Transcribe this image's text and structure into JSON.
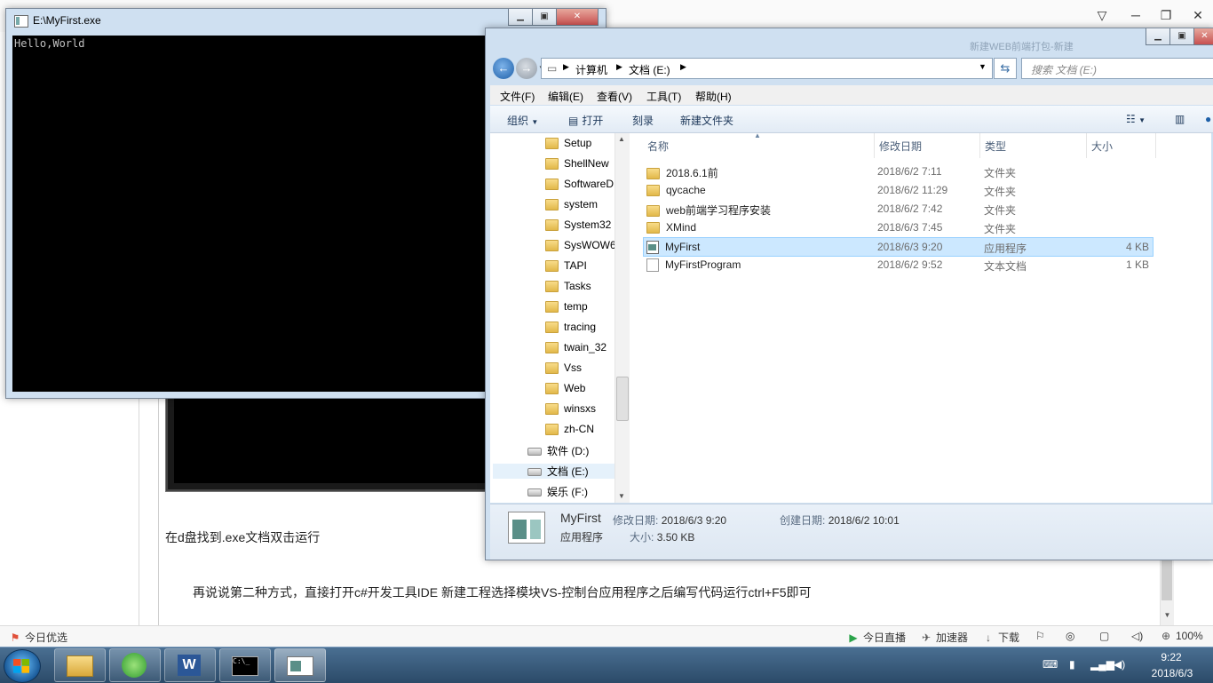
{
  "browser": {
    "caption": "在d盘找到.exe文档双击运行",
    "paragraph": "再说说第二种方式，直接打开c#开发工具IDE  新建工程选择模块VS-控制台应用程序之后编写代码运行ctrl+F5即可",
    "statusbar": {
      "left_label": "今日优选",
      "live": "今日直播",
      "accelerator": "加速器",
      "download": "下载",
      "zoom": "100%"
    }
  },
  "console": {
    "title": "E:\\MyFirst.exe",
    "output": "Hello,World"
  },
  "explorer": {
    "faded_title": "新建WEB前端打包-新建",
    "address": {
      "seg1": "计算机",
      "seg2": "文档 (E:)"
    },
    "search_placeholder": "搜索 文档 (E:)",
    "menu": [
      "文件(F)",
      "编辑(E)",
      "查看(V)",
      "工具(T)",
      "帮助(H)"
    ],
    "toolbar": {
      "organize": "组织",
      "open": "打开",
      "burn": "刻录",
      "new_folder": "新建文件夹"
    },
    "tree": [
      {
        "label": "Setup",
        "type": "folder"
      },
      {
        "label": "ShellNew",
        "type": "folder"
      },
      {
        "label": "SoftwareD",
        "type": "folder"
      },
      {
        "label": "system",
        "type": "folder"
      },
      {
        "label": "System32",
        "type": "folder"
      },
      {
        "label": "SysWOW6",
        "type": "folder"
      },
      {
        "label": "TAPI",
        "type": "folder"
      },
      {
        "label": "Tasks",
        "type": "folder"
      },
      {
        "label": "temp",
        "type": "folder"
      },
      {
        "label": "tracing",
        "type": "folder"
      },
      {
        "label": "twain_32",
        "type": "folder"
      },
      {
        "label": "Vss",
        "type": "folder"
      },
      {
        "label": "Web",
        "type": "folder"
      },
      {
        "label": "winsxs",
        "type": "folder"
      },
      {
        "label": "zh-CN",
        "type": "folder"
      },
      {
        "label": "软件 (D:)",
        "type": "drive"
      },
      {
        "label": "文档 (E:)",
        "type": "drive"
      },
      {
        "label": "娱乐 (F:)",
        "type": "drive"
      }
    ],
    "columns": {
      "name": "名称",
      "modified": "修改日期",
      "type": "类型",
      "size": "大小"
    },
    "files": [
      {
        "name": "2018.6.1前",
        "modified": "2018/6/2 7:11",
        "type": "文件夹",
        "size": "",
        "icon": "folder"
      },
      {
        "name": "qycache",
        "modified": "2018/6/2 11:29",
        "type": "文件夹",
        "size": "",
        "icon": "folder"
      },
      {
        "name": "web前端学习程序安装",
        "modified": "2018/6/2 7:42",
        "type": "文件夹",
        "size": "",
        "icon": "folder"
      },
      {
        "name": "XMind",
        "modified": "2018/6/3 7:45",
        "type": "文件夹",
        "size": "",
        "icon": "folder"
      },
      {
        "name": "MyFirst",
        "modified": "2018/6/3 9:20",
        "type": "应用程序",
        "size": "4 KB",
        "icon": "exe"
      },
      {
        "name": "MyFirstProgram",
        "modified": "2018/6/2 9:52",
        "type": "文本文档",
        "size": "1 KB",
        "icon": "txt"
      }
    ],
    "details": {
      "name": "MyFirst",
      "modified_label": "修改日期:",
      "modified": "2018/6/3 9:20",
      "created_label": "创建日期:",
      "created": "2018/6/2 10:01",
      "type": "应用程序",
      "size_label": "大小:",
      "size": "3.50 KB"
    }
  },
  "taskbar": {
    "time": "9:22",
    "date": "2018/6/3"
  }
}
